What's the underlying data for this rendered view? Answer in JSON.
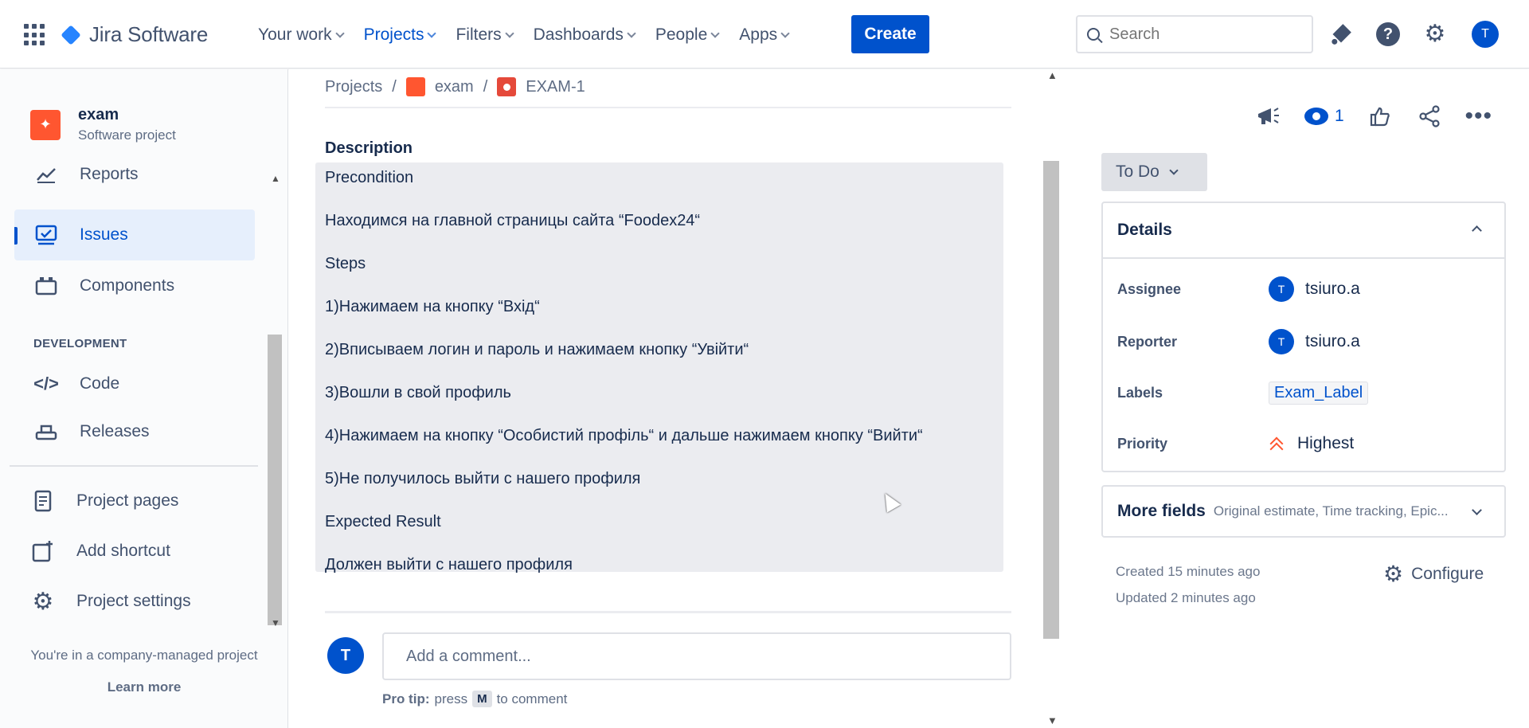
{
  "topbar": {
    "app_name": "Jira Software",
    "nav": [
      {
        "label": "Your work"
      },
      {
        "label": "Projects"
      },
      {
        "label": "Filters"
      },
      {
        "label": "Dashboards"
      },
      {
        "label": "People"
      },
      {
        "label": "Apps"
      }
    ],
    "create_label": "Create",
    "search_placeholder": "Search",
    "avatar_initial": "T",
    "help_glyph": "?"
  },
  "sidebar": {
    "project_icon_glyph": "✦",
    "project_name": "exam",
    "project_type": "Software project",
    "items": [
      {
        "label": "Reports",
        "icon": "chart-icon"
      },
      {
        "label": "Issues",
        "icon": "issues-icon"
      },
      {
        "label": "Components",
        "icon": "components-icon"
      },
      {
        "label": "Code",
        "icon": "code-icon"
      },
      {
        "label": "Releases",
        "icon": "releases-icon"
      },
      {
        "label": "Project pages",
        "icon": "page-icon"
      },
      {
        "label": "Add shortcut",
        "icon": "add-shortcut-icon"
      },
      {
        "label": "Project settings",
        "icon": "gear-icon"
      }
    ],
    "section_development": "DEVELOPMENT",
    "footer_text": "You're in a company-managed project",
    "learn_more": "Learn more"
  },
  "main": {
    "breadcrumb": [
      "Projects",
      "exam",
      "EXAM-1"
    ],
    "breadcrumb_sep": "/",
    "description_label": "Description",
    "description_lines": [
      "Precondition",
      "Находимся на главной страницы сайта “Foodex24“",
      "Steps",
      "1)Нажимаем на кнопку “Вхід“",
      "2)Вписываем логин и пароль и нажимаем кнопку “Увійти“",
      "3)Вошли в свой профиль",
      "4)Нажимаем на кнопку “Особистий профіль“ и дальше нажимаем кнопку “Вийти“",
      "5)Не получилось выйти с нашего профиля",
      "Expected Result",
      "Должен выйти с нашего профиля"
    ],
    "comment_avatar": "T",
    "comment_placeholder": "Add a comment...",
    "protip_bold": "Pro tip:",
    "protip_press": "press",
    "protip_key": "M",
    "protip_rest": "to comment"
  },
  "panel": {
    "watchers_count": "1",
    "status": "To Do",
    "details_title": "Details",
    "fields": [
      {
        "label": "Assignee",
        "value": "tsiuro.a",
        "avatar": "T"
      },
      {
        "label": "Reporter",
        "value": "tsiuro.a",
        "avatar": "T"
      },
      {
        "label": "Labels",
        "value": "Exam_Label"
      },
      {
        "label": "Priority",
        "value": "Highest"
      }
    ],
    "more_fields_title": "More fields",
    "more_fields_sub": "Original estimate, Time tracking, Epic...",
    "created": "Created 15 minutes ago",
    "updated": "Updated 2 minutes ago",
    "configure": "Configure"
  },
  "colors": {
    "accent": "#0052CC",
    "priority_highest": "#FF5630",
    "project_icon": "#FF5630"
  }
}
